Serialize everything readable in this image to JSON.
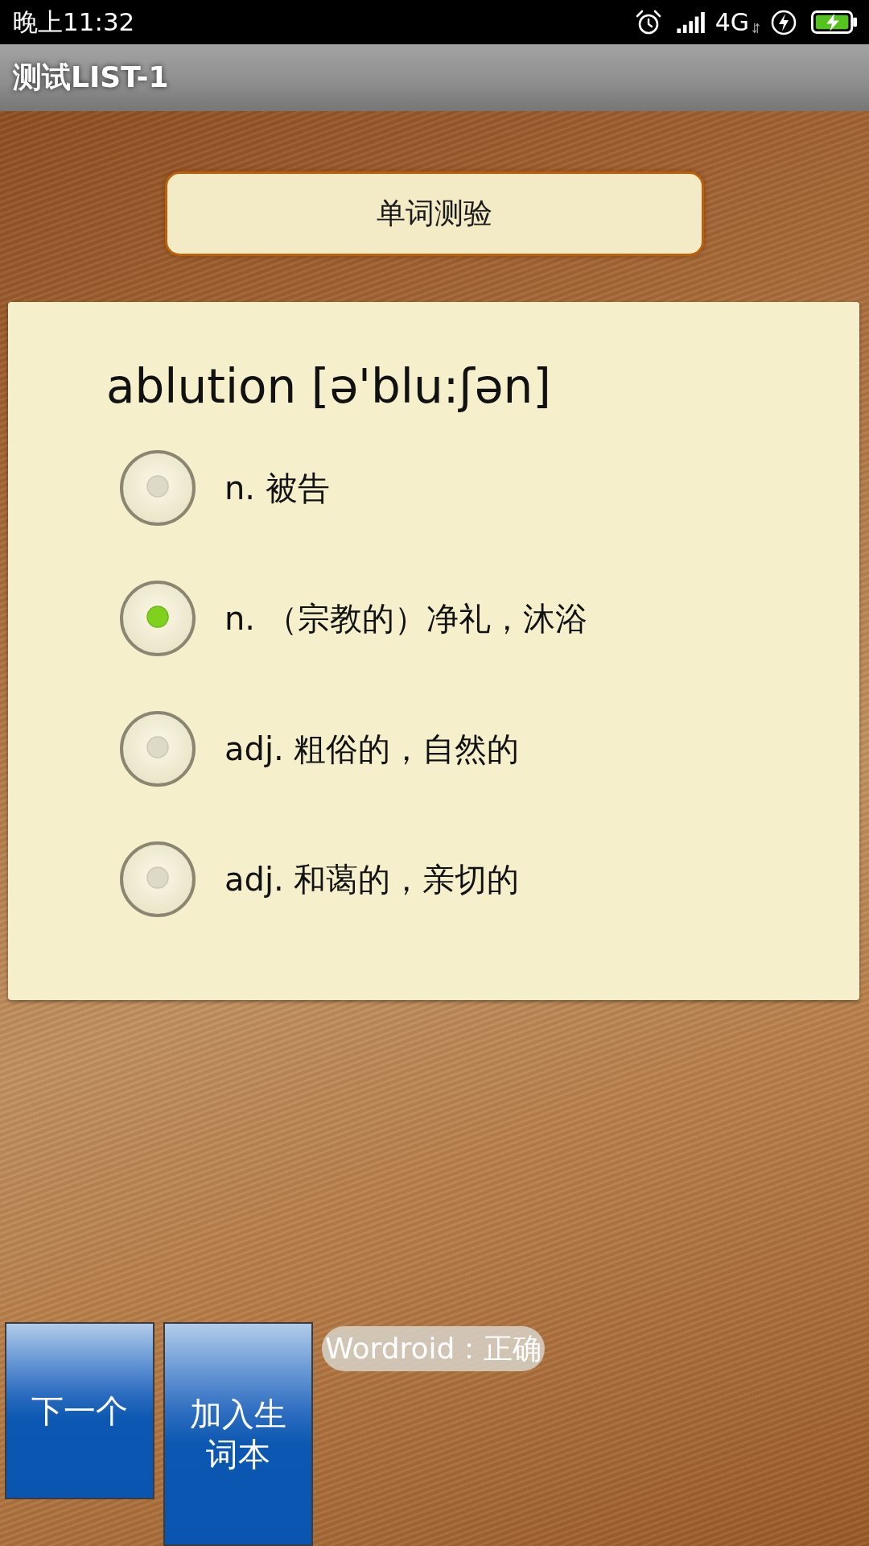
{
  "status_bar": {
    "time": "晚上11:32",
    "network": "4G"
  },
  "app_bar": {
    "title": "测试LIST-1"
  },
  "quiz_label": "单词测验",
  "question": {
    "word": "ablution [ə'blu:ʃən]",
    "options": [
      {
        "label": "n. 被告",
        "selected": false
      },
      {
        "label": "n. （宗教的）净礼，沐浴",
        "selected": true
      },
      {
        "label": "adj. 粗俗的，自然的",
        "selected": false
      },
      {
        "label": "adj. 和蔼的，亲切的",
        "selected": false
      }
    ]
  },
  "buttons": [
    {
      "label": "下一个"
    },
    {
      "label": "加入生词本"
    }
  ],
  "toast": "Wordroid：正确"
}
